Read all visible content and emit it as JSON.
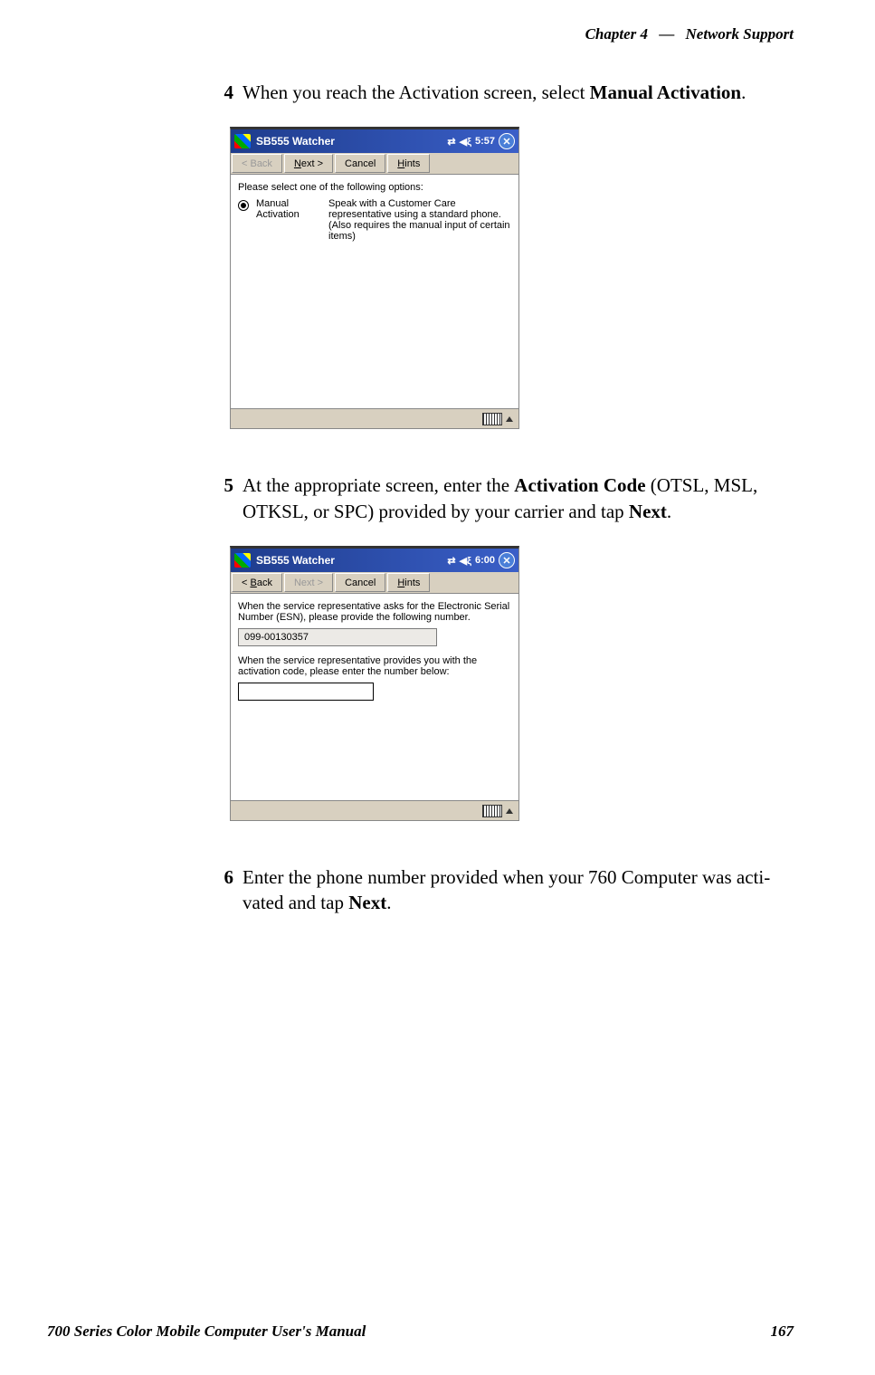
{
  "header": {
    "chapter": "Chapter",
    "chapter_num": "4",
    "sep": "—",
    "title": "Network Support"
  },
  "steps": {
    "s4": {
      "num": "4",
      "pre": "When you reach the Activation screen, select ",
      "bold": "Manual Activation",
      "post": "."
    },
    "s5": {
      "num": "5",
      "pre": "At the appropriate screen, enter the ",
      "bold1": "Activation Code",
      "mid": " (OTSL, MSL, OTKSL, or SPC) provided by your carrier and tap ",
      "bold2": "Next",
      "post": "."
    },
    "s6": {
      "num": "6",
      "pre": "Enter the phone number provided when your 760 Computer was acti­vated and tap ",
      "bold": "Next",
      "post": "."
    }
  },
  "pda1": {
    "title": "SB555 Watcher",
    "time": "5:57",
    "back": "< Back",
    "next": "Next >",
    "cancel": "Cancel",
    "hints": "Hints",
    "prompt": "Please select one of the following options:",
    "opt_label1": "Manual",
    "opt_label2": "Activation",
    "opt_desc": "Speak with a Customer Care representative using a standard phone.  (Also requires the manual input of certain items)"
  },
  "pda2": {
    "title": "SB555 Watcher",
    "time": "6:00",
    "back": "< Back",
    "next": "Next >",
    "cancel": "Cancel",
    "hints": "Hints",
    "line1": "When the service representative asks for the Electronic Serial Number (ESN), please provide the following number.",
    "esn": "099-00130357",
    "line2": "When the service representative provides you with the activation code, please enter the number below:"
  },
  "footer": {
    "manual": "700 Series Color Mobile Computer User's Manual",
    "page": "167"
  }
}
